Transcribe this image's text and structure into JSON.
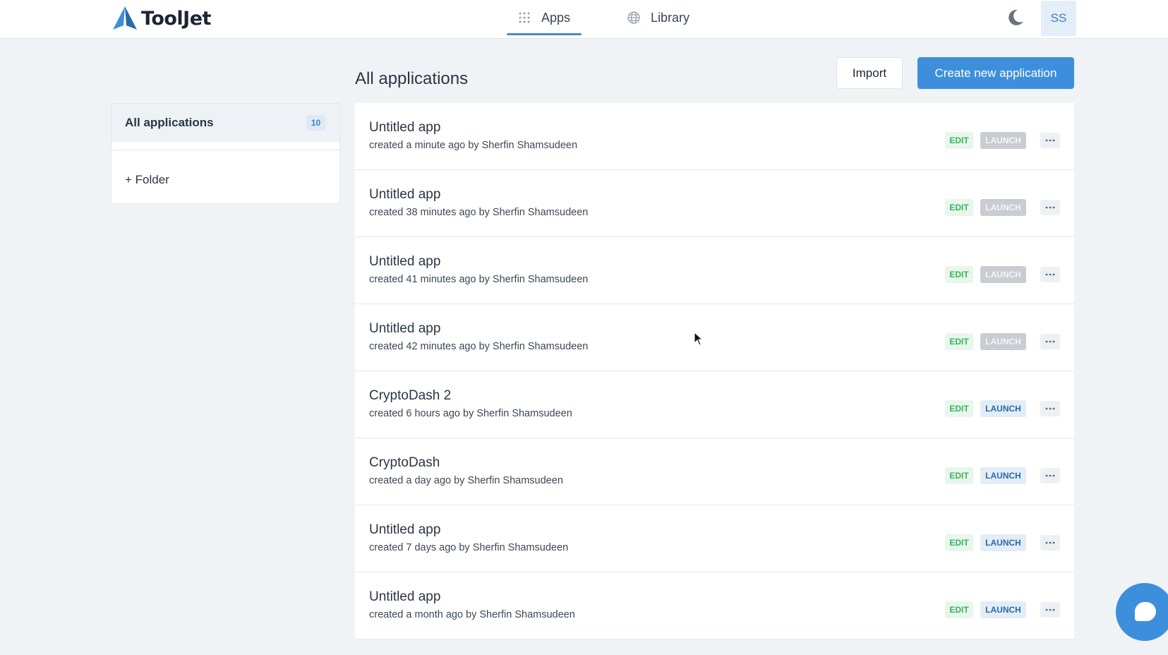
{
  "brand": {
    "name": "ToolJet",
    "accent": "#3d8fdb"
  },
  "nav": {
    "tabs": [
      {
        "label": "Apps",
        "icon": "grid-icon",
        "active": true
      },
      {
        "label": "Library",
        "icon": "globe-icon",
        "active": false
      }
    ],
    "theme_icon": "moon-icon",
    "avatar_initials": "SS"
  },
  "sidebar": {
    "all_label": "All applications",
    "all_count": "10",
    "folder_label": "+ Folder"
  },
  "main": {
    "title": "All applications",
    "import_label": "Import",
    "create_label": "Create new application"
  },
  "apps": [
    {
      "name": "Untitled app",
      "meta": "created a minute ago by Sherfin Shamsudeen",
      "edit": "EDIT",
      "launch": "LAUNCH",
      "launch_enabled": false
    },
    {
      "name": "Untitled app",
      "meta": "created 38 minutes ago by Sherfin Shamsudeen",
      "edit": "EDIT",
      "launch": "LAUNCH",
      "launch_enabled": false
    },
    {
      "name": "Untitled app",
      "meta": "created 41 minutes ago by Sherfin Shamsudeen",
      "edit": "EDIT",
      "launch": "LAUNCH",
      "launch_enabled": false
    },
    {
      "name": "Untitled app",
      "meta": "created 42 minutes ago by Sherfin Shamsudeen",
      "edit": "EDIT",
      "launch": "LAUNCH",
      "launch_enabled": false
    },
    {
      "name": "CryptoDash 2",
      "meta": "created 6 hours ago by Sherfin Shamsudeen",
      "edit": "EDIT",
      "launch": "LAUNCH",
      "launch_enabled": true
    },
    {
      "name": "CryptoDash",
      "meta": "created a day ago by Sherfin Shamsudeen",
      "edit": "EDIT",
      "launch": "LAUNCH",
      "launch_enabled": true
    },
    {
      "name": "Untitled app",
      "meta": "created 7 days ago by Sherfin Shamsudeen",
      "edit": "EDIT",
      "launch": "LAUNCH",
      "launch_enabled": true
    },
    {
      "name": "Untitled app",
      "meta": "created a month ago by Sherfin Shamsudeen",
      "edit": "EDIT",
      "launch": "LAUNCH",
      "launch_enabled": true
    }
  ],
  "chat": {
    "icon": "chat-icon"
  }
}
